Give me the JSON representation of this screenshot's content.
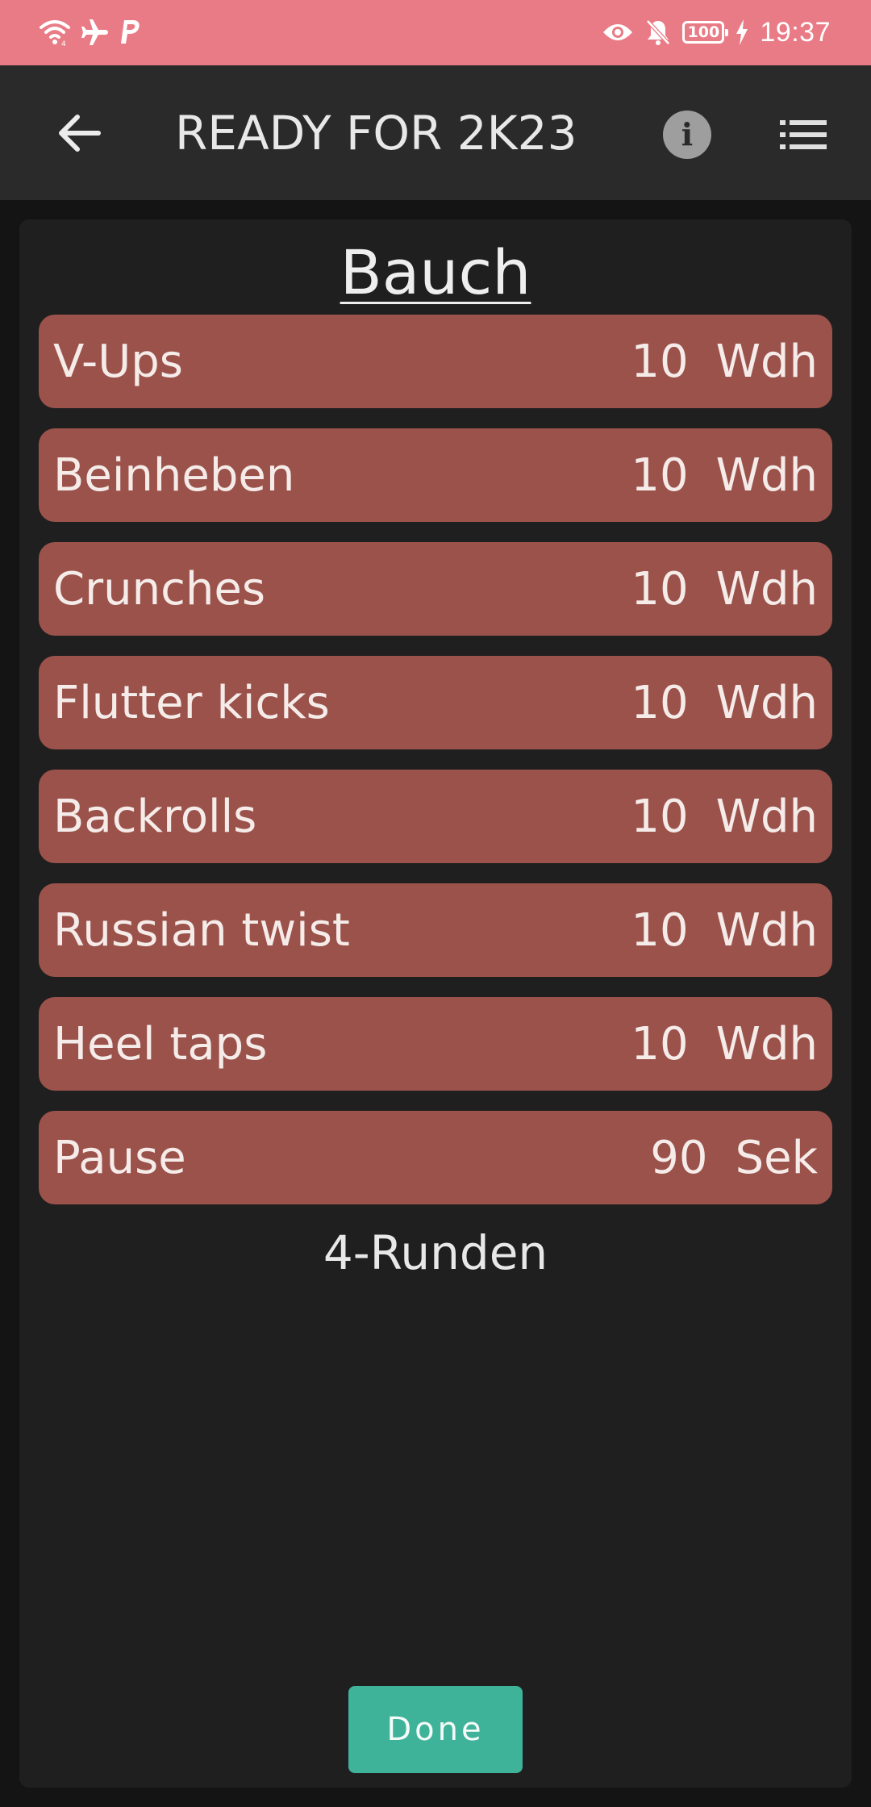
{
  "status_bar": {
    "left_icons": [
      "wifi-icon",
      "airplane-icon",
      "paypal-icon"
    ],
    "right_icons": [
      "eye-icon",
      "bell-off-icon",
      "battery-icon",
      "charging-icon"
    ],
    "battery_level": "100",
    "time": "19:37",
    "background_color": "#e97b86"
  },
  "app_bar": {
    "title": "READY FOR 2K23",
    "back_icon": "arrow-left-icon",
    "info_icon": "info-icon",
    "list_icon": "list-icon"
  },
  "workout": {
    "section_title": "Bauch",
    "exercises": [
      {
        "name": "V-Ups",
        "value": "10",
        "unit": "Wdh"
      },
      {
        "name": "Beinheben",
        "value": "10",
        "unit": "Wdh"
      },
      {
        "name": "Crunches",
        "value": "10",
        "unit": "Wdh"
      },
      {
        "name": "Flutter kicks",
        "value": "10",
        "unit": "Wdh"
      },
      {
        "name": "Backrolls",
        "value": "10",
        "unit": "Wdh"
      },
      {
        "name": "Russian twist",
        "value": "10",
        "unit": "Wdh"
      },
      {
        "name": "Heel taps",
        "value": "10",
        "unit": "Wdh"
      },
      {
        "name": "Pause",
        "value": "90",
        "unit": "Sek"
      }
    ],
    "rounds_label": "4-Runden",
    "exercise_color": "#9b524b"
  },
  "done_button": {
    "label": "Done",
    "color": "#3fb39a"
  }
}
